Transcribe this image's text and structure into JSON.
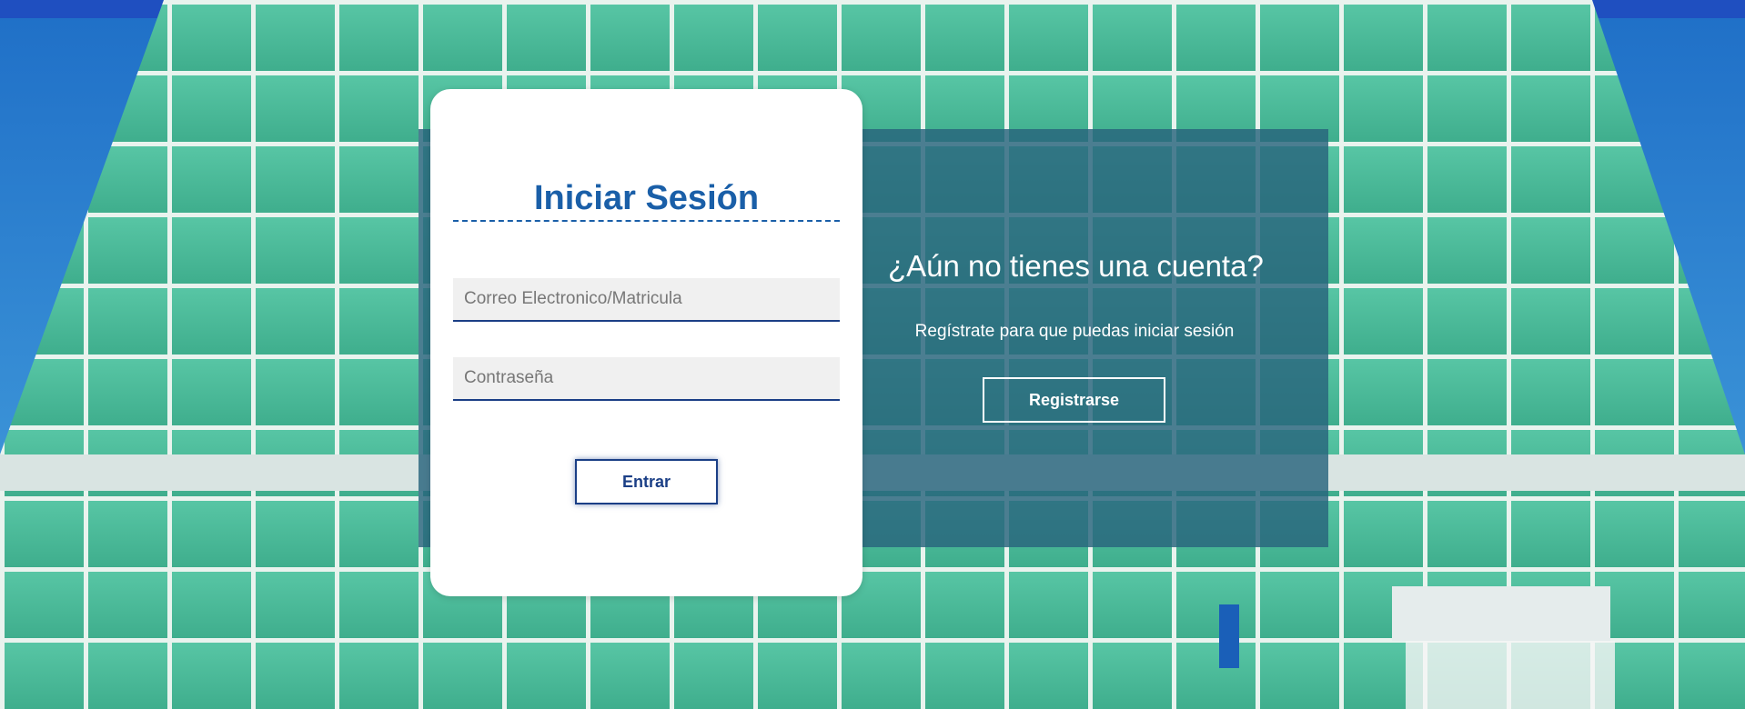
{
  "login": {
    "title": "Iniciar Sesión",
    "email_placeholder": "Correo Electronico/Matricula",
    "email_value": "",
    "password_placeholder": "Contraseña",
    "password_value": "",
    "submit_label": "Entrar"
  },
  "register": {
    "question": "¿Aún no tienes una cuenta?",
    "description": "Regístrate para que puedas iniciar sesión",
    "button_label": "Registrarse"
  },
  "colors": {
    "accent": "#1a5fa8",
    "border": "#1b3f86",
    "overlay": "#28647d"
  }
}
